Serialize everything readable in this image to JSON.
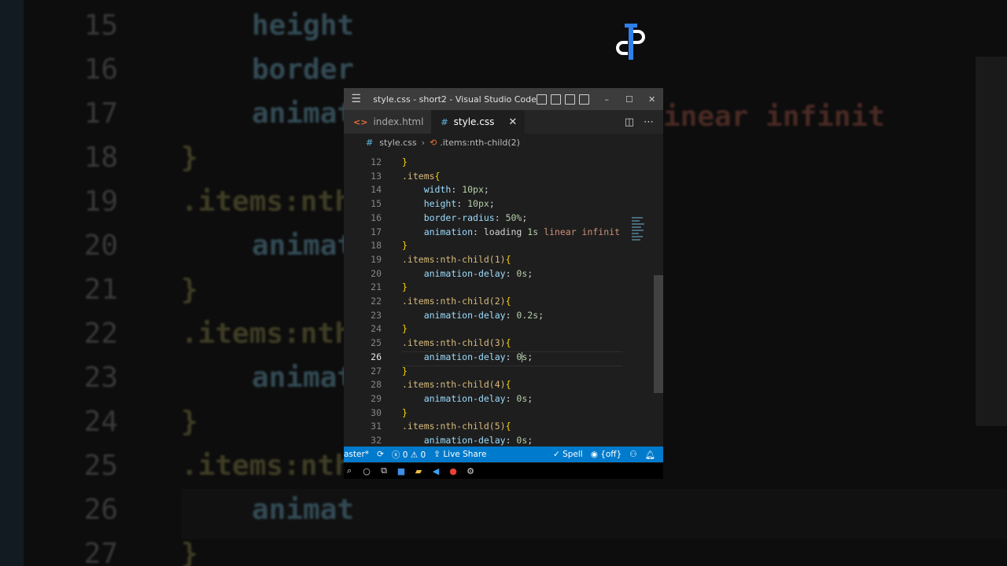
{
  "background": {
    "lines": [
      {
        "n": "15",
        "text": "height"
      },
      {
        "n": "16",
        "text": "border"
      },
      {
        "n": "17",
        "text": "animat"
      },
      {
        "n": "18",
        "text": "}"
      },
      {
        "n": "19",
        "text": ".items:nth"
      },
      {
        "n": "20",
        "text": "animat"
      },
      {
        "n": "21",
        "text": "}"
      },
      {
        "n": "22",
        "text": ".items:nth"
      },
      {
        "n": "23",
        "text": "animat"
      },
      {
        "n": "24",
        "text": "}"
      },
      {
        "n": "25",
        "text": ".items:nth"
      },
      {
        "n": "26",
        "text": "animat"
      },
      {
        "n": "27",
        "text": "}"
      }
    ],
    "right_text": "inear infinit"
  },
  "window": {
    "title": "style.css - short2 - Visual Studio Code",
    "minimize": "–",
    "maximize": "☐",
    "close": "✕"
  },
  "tabs": [
    {
      "label": "index.html",
      "icon": "<>",
      "active": false
    },
    {
      "label": "style.css",
      "icon": "#",
      "active": true,
      "close": "✕"
    }
  ],
  "breadcrumb": {
    "file": "style.css",
    "symbol": ".items:nth-child(2)"
  },
  "code_lines": [
    {
      "n": "12",
      "parts": [
        {
          "t": "}",
          "c": "brace"
        }
      ]
    },
    {
      "n": "13",
      "parts": [
        {
          "t": ".items",
          "c": "sel"
        },
        {
          "t": "{",
          "c": "brace"
        }
      ]
    },
    {
      "n": "14",
      "parts": [
        {
          "t": "    "
        },
        {
          "t": "width",
          "c": "prop"
        },
        {
          "t": ": "
        },
        {
          "t": "10px",
          "c": "num"
        },
        {
          "t": ";"
        }
      ]
    },
    {
      "n": "15",
      "parts": [
        {
          "t": "    "
        },
        {
          "t": "height",
          "c": "prop"
        },
        {
          "t": ": "
        },
        {
          "t": "10px",
          "c": "num"
        },
        {
          "t": ";"
        }
      ]
    },
    {
      "n": "16",
      "parts": [
        {
          "t": "    "
        },
        {
          "t": "border-radius",
          "c": "prop"
        },
        {
          "t": ": "
        },
        {
          "t": "50%",
          "c": "num"
        },
        {
          "t": ";"
        }
      ]
    },
    {
      "n": "17",
      "parts": [
        {
          "t": "    "
        },
        {
          "t": "animation",
          "c": "prop"
        },
        {
          "t": ": loading "
        },
        {
          "t": "1s",
          "c": "num"
        },
        {
          "t": " "
        },
        {
          "t": "linear infinit",
          "c": "kw"
        }
      ]
    },
    {
      "n": "18",
      "parts": [
        {
          "t": "}",
          "c": "brace"
        }
      ]
    },
    {
      "n": "19",
      "parts": [
        {
          "t": ".items:nth-child(1)",
          "c": "sel"
        },
        {
          "t": "{",
          "c": "brace"
        }
      ]
    },
    {
      "n": "20",
      "parts": [
        {
          "t": "    "
        },
        {
          "t": "animation-delay",
          "c": "prop"
        },
        {
          "t": ": "
        },
        {
          "t": "0s",
          "c": "num"
        },
        {
          "t": ";"
        }
      ]
    },
    {
      "n": "21",
      "parts": [
        {
          "t": "}",
          "c": "brace"
        }
      ]
    },
    {
      "n": "22",
      "parts": [
        {
          "t": ".items:nth-child(2)",
          "c": "sel"
        },
        {
          "t": "{",
          "c": "brace"
        }
      ]
    },
    {
      "n": "23",
      "parts": [
        {
          "t": "    "
        },
        {
          "t": "animation-delay",
          "c": "prop"
        },
        {
          "t": ": "
        },
        {
          "t": "0.2s",
          "c": "num"
        },
        {
          "t": ";"
        }
      ]
    },
    {
      "n": "24",
      "parts": [
        {
          "t": "}",
          "c": "brace"
        }
      ]
    },
    {
      "n": "25",
      "parts": [
        {
          "t": ".items:nth-child(3)",
          "c": "sel"
        },
        {
          "t": "{",
          "c": "brace"
        }
      ]
    },
    {
      "n": "26",
      "parts": [
        {
          "t": "    "
        },
        {
          "t": "animation-delay",
          "c": "prop"
        },
        {
          "t": ": "
        },
        {
          "t": "0",
          "c": "num"
        },
        {
          "t": "|caret|"
        },
        {
          "t": "s",
          "c": "num"
        },
        {
          "t": ";"
        }
      ],
      "current": true
    },
    {
      "n": "27",
      "parts": [
        {
          "t": "}",
          "c": "brace"
        }
      ]
    },
    {
      "n": "28",
      "parts": [
        {
          "t": ".items:nth-child(4)",
          "c": "sel"
        },
        {
          "t": "{",
          "c": "brace"
        }
      ]
    },
    {
      "n": "29",
      "parts": [
        {
          "t": "    "
        },
        {
          "t": "animation-delay",
          "c": "prop"
        },
        {
          "t": ": "
        },
        {
          "t": "0s",
          "c": "num"
        },
        {
          "t": ";"
        }
      ]
    },
    {
      "n": "30",
      "parts": [
        {
          "t": "}",
          "c": "brace"
        }
      ]
    },
    {
      "n": "31",
      "parts": [
        {
          "t": ".items:nth-child(5)",
          "c": "sel"
        },
        {
          "t": "{",
          "c": "brace"
        }
      ]
    },
    {
      "n": "32",
      "parts": [
        {
          "t": "    "
        },
        {
          "t": "animation-delay",
          "c": "prop"
        },
        {
          "t": ": "
        },
        {
          "t": "0s",
          "c": "num"
        },
        {
          "t": ";"
        }
      ]
    }
  ],
  "status": {
    "branch": "aster*",
    "errors": "0",
    "warnings": "0",
    "live_share": "Live Share",
    "spell": "Spell",
    "off": "{off}"
  },
  "colors": {
    "status_bar": "#007acc",
    "title_bar": "#3c3c3c",
    "editor_bg": "#1e1e1e"
  }
}
